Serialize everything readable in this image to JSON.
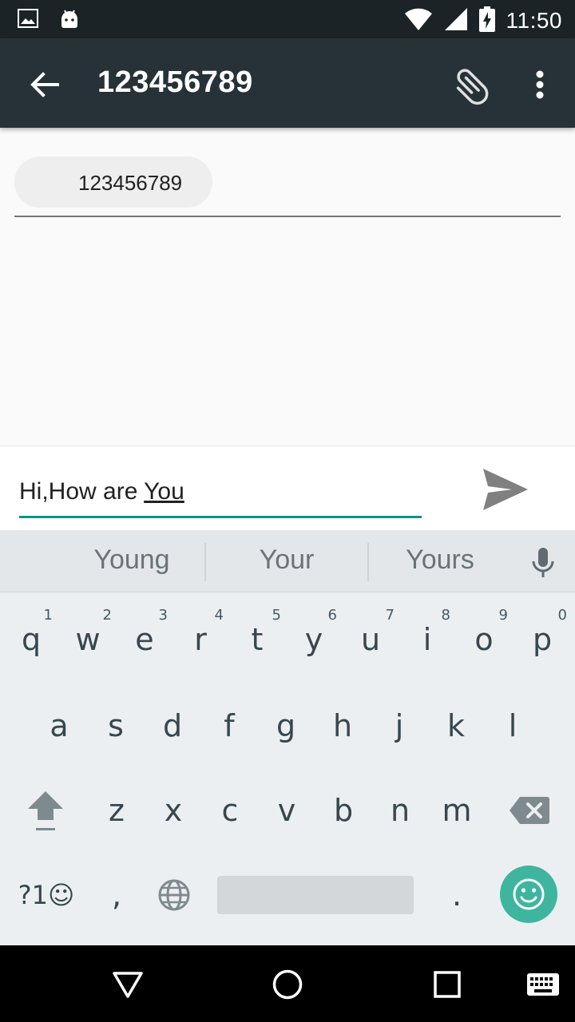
{
  "status_bar": {
    "time": "11:50",
    "icons": [
      "image-notification-icon",
      "android-notification-icon",
      "wifi-icon",
      "signal-icon",
      "battery-charging-icon"
    ]
  },
  "app_bar": {
    "title": "123456789",
    "back_icon": "arrow-back-icon",
    "attach_icon": "paperclip-icon",
    "more_icon": "more-vert-icon"
  },
  "recipient": {
    "chip_text": "123456789"
  },
  "compose": {
    "text_before": "Hi,How are ",
    "text_composing": "You",
    "send_icon": "send-icon",
    "accent_color": "#009688"
  },
  "keyboard": {
    "suggestions": [
      "Young",
      "Your",
      "Yours"
    ],
    "row1": [
      {
        "label": "q",
        "hint": "1"
      },
      {
        "label": "w",
        "hint": "2"
      },
      {
        "label": "e",
        "hint": "3"
      },
      {
        "label": "r",
        "hint": "4"
      },
      {
        "label": "t",
        "hint": "5"
      },
      {
        "label": "y",
        "hint": "6"
      },
      {
        "label": "u",
        "hint": "7"
      },
      {
        "label": "i",
        "hint": "8"
      },
      {
        "label": "o",
        "hint": "9"
      },
      {
        "label": "p",
        "hint": "0"
      }
    ],
    "row2": [
      "a",
      "s",
      "d",
      "f",
      "g",
      "h",
      "j",
      "k",
      "l"
    ],
    "row3": [
      "z",
      "x",
      "c",
      "v",
      "b",
      "n",
      "m"
    ],
    "symbols_label": "?1☺",
    "comma_label": ",",
    "period_label": ".",
    "emoji_color": "#3fb59f"
  },
  "nav_bar": {
    "icons": [
      "back-triangle-icon",
      "home-circle-icon",
      "recents-square-icon",
      "keyboard-switch-icon"
    ]
  }
}
